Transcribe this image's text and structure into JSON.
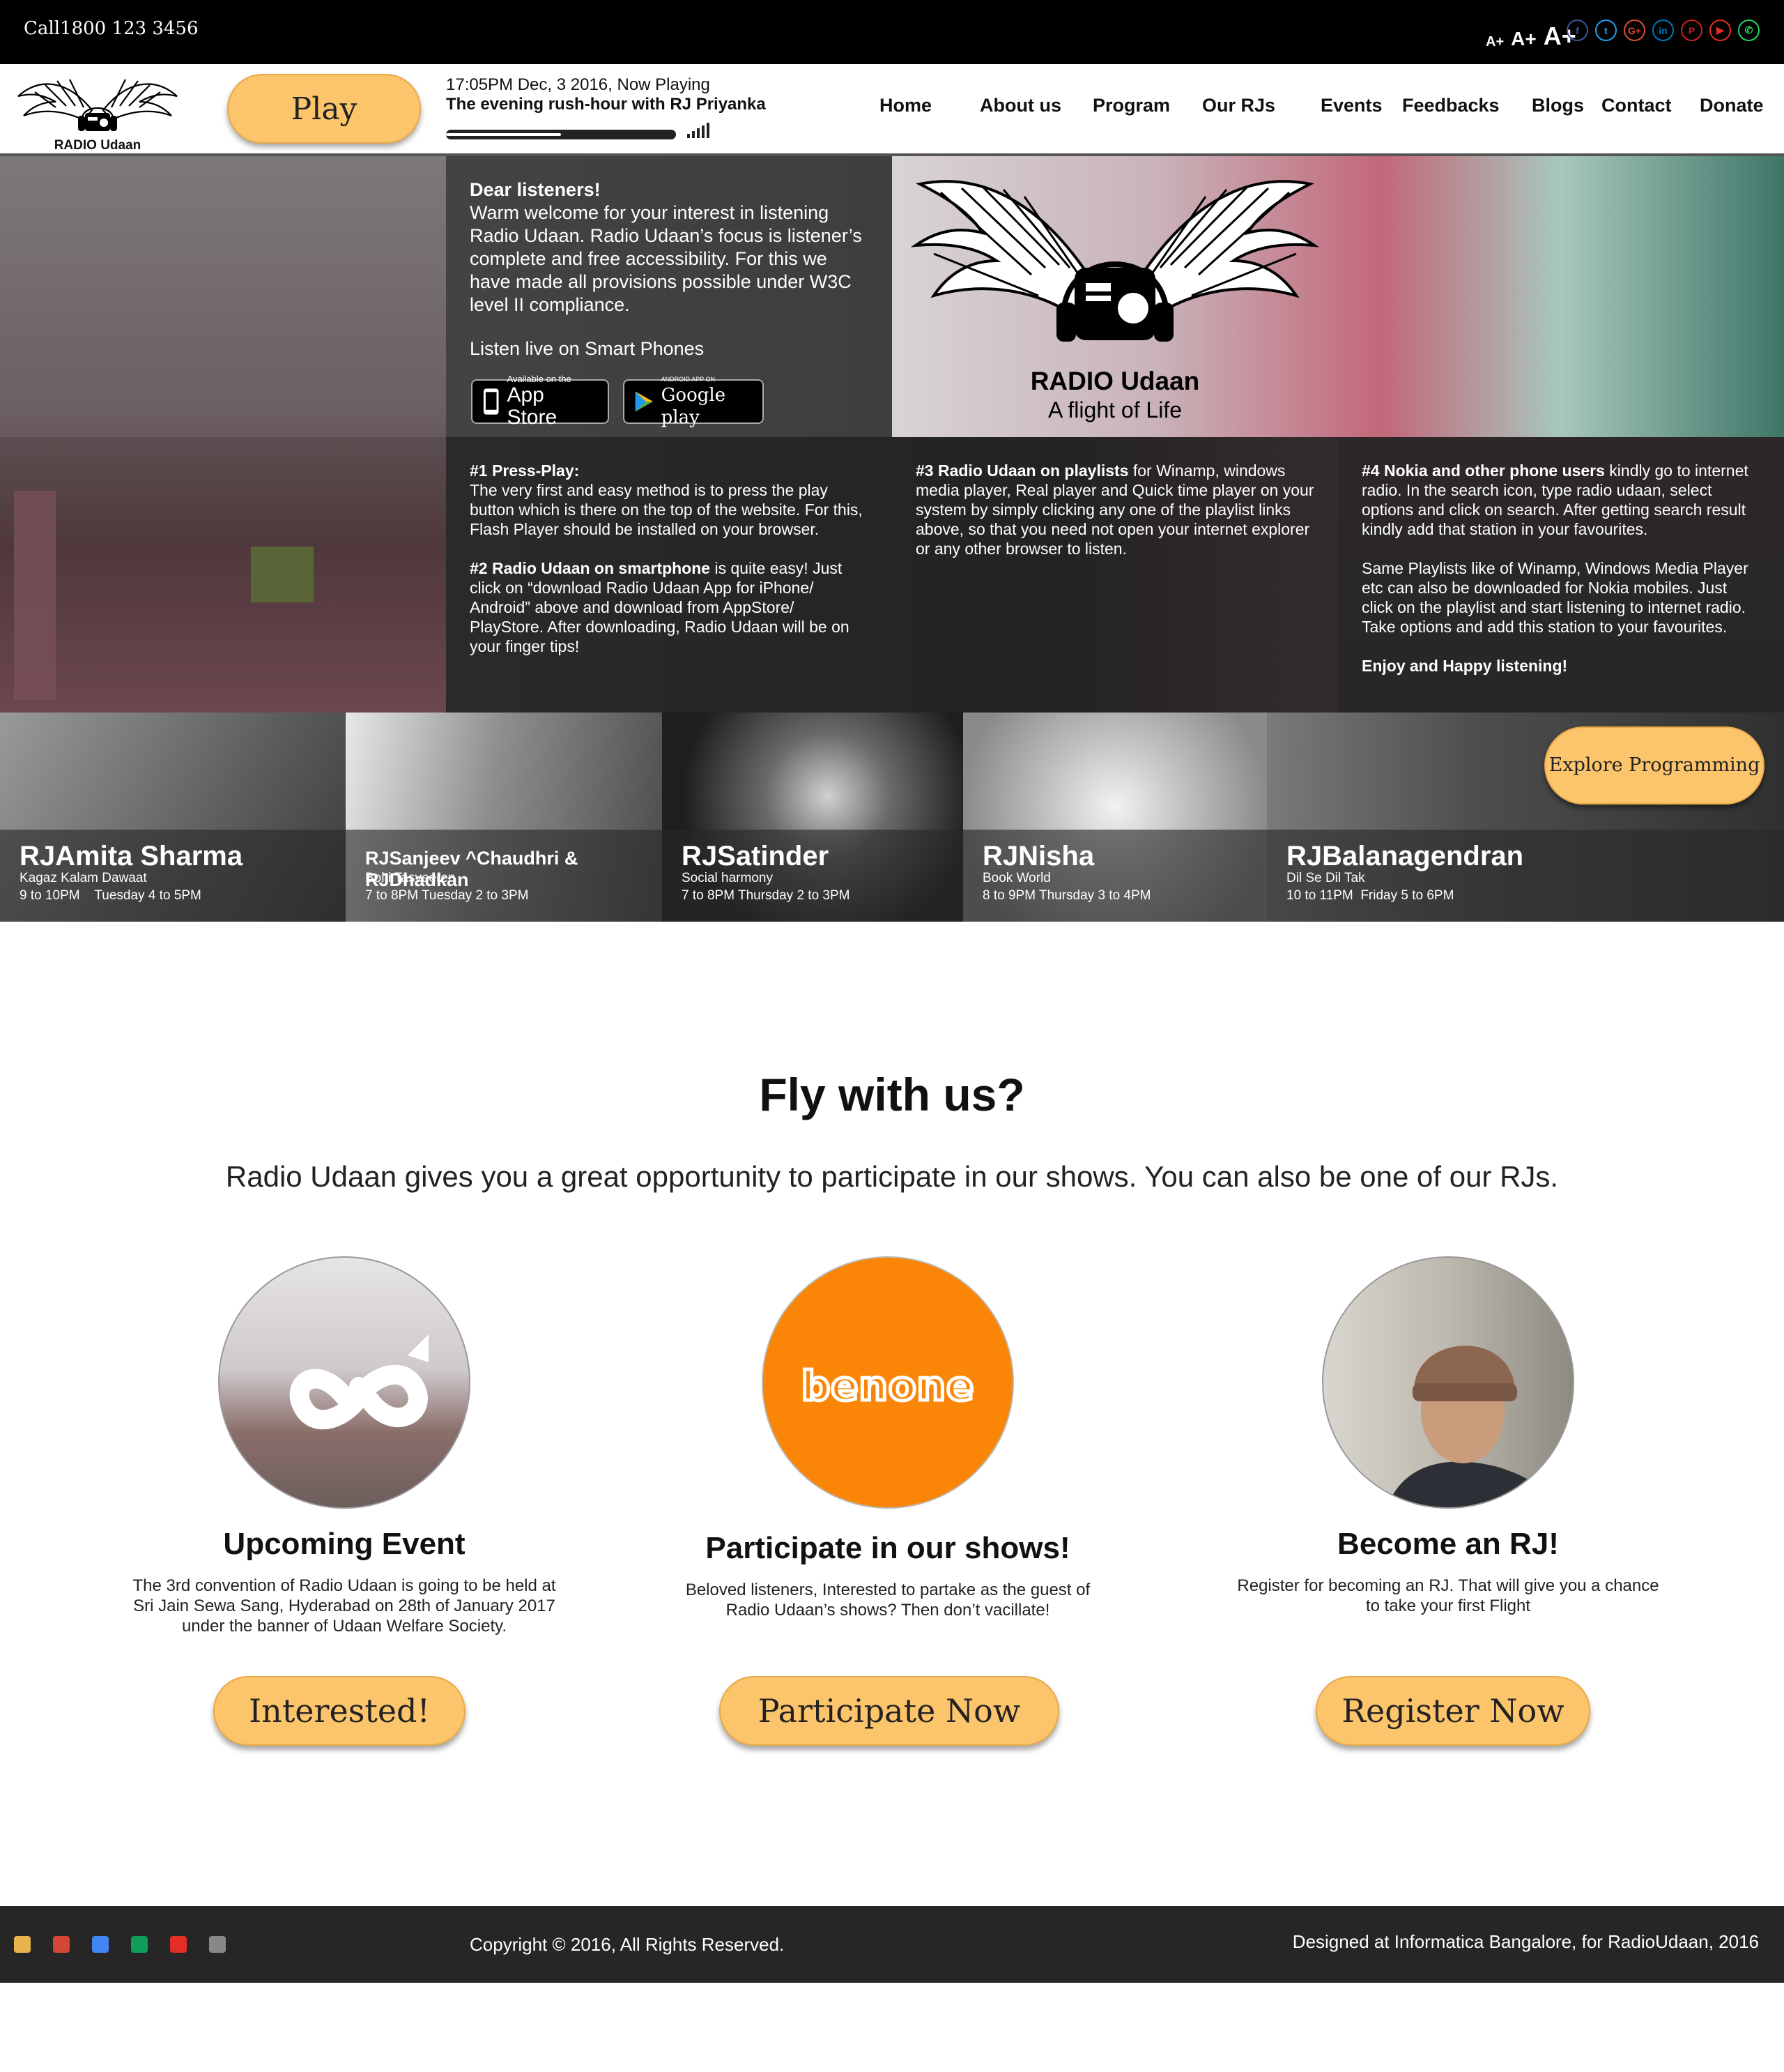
{
  "topbar": {
    "call": "Call1800 123 3456",
    "font_controls": [
      "A+",
      "A+",
      "A+"
    ],
    "socials": [
      {
        "icon": "facebook-icon",
        "glyph": "f",
        "color": "#3b5998"
      },
      {
        "icon": "twitter-icon",
        "glyph": "t",
        "color": "#1da1f2"
      },
      {
        "icon": "google-plus-icon",
        "glyph": "G+",
        "color": "#dd4b39"
      },
      {
        "icon": "linkedin-icon",
        "glyph": "in",
        "color": "#0077b5"
      },
      {
        "icon": "pinterest-icon",
        "glyph": "P",
        "color": "#cb2027"
      },
      {
        "icon": "youtube-icon",
        "glyph": "▶",
        "color": "#e52d27"
      },
      {
        "icon": "whatsapp-icon",
        "glyph": "✆",
        "color": "#25d366"
      }
    ]
  },
  "header": {
    "logo_text": "RADIO Udaan",
    "play_label": "Play",
    "now_time": "17:05PM Dec, 3 2016, Now Playing",
    "now_show": "The evening rush-hour with RJ Priyanka",
    "progress": 0.5,
    "nav": [
      "Home",
      "About us",
      "Program",
      "Our RJs",
      "Events",
      "Feedbacks",
      "Blogs",
      "Contact",
      "Donate"
    ]
  },
  "hero": {
    "welcome_title": "Dear listeners!",
    "welcome_body": "Warm welcome for your interest in listening Radio Udaan. Radio Udaan’s focus is listener’s complete and free accessibility. For this we have made all provisions possible under W3C level II compliance.",
    "listen_live": "Listen live on Smart Phones",
    "appstore_small": "Available on the",
    "appstore_big": "App Store",
    "googleplay_small": "ANDROID APP ON",
    "googleplay_big": "Google play",
    "brand_name": "RADIO Udaan",
    "brand_tagline": "A flight of Life",
    "step1_title": "#1 Press-Play:",
    "step1_body": "The very first and easy method is to press the play button which is there on the top of the website. For this, Flash Player should be installed on your browser.",
    "step2_title": "#2 Radio Udaan on smartphone",
    "step2_body": " is quite easy! Just click on “download Radio Udaan App for iPhone/ Android”  above and download from AppStore/ PlayStore. After downloading, Radio Udaan will be on your finger tips!",
    "step3_title": "#3 Radio Udaan on playlists",
    "step3_body": " for Winamp, windows media player, Real player and Quick time player on your system by simply clicking any one of the playlist links above, so that you need not open your internet explorer or any other browser to listen.",
    "step4_title": "#4 Nokia and other phone users",
    "step4_body": " kindly go to internet radio. In the search icon, type radio udaan, select options and click on search. After getting search result kindly add that station in your favourites.",
    "step4_more": "Same Playlists like of  Winamp, Windows Media Player etc can also be downloaded for Nokia mobiles. Just click on the playlist and start listening to internet radio. Take options and add this station to your favourites.",
    "step4_end": "Enjoy and Happy listening!"
  },
  "rjs": [
    {
      "name": "RJAmita Sharma",
      "show": "Kagaz Kalam Dawaat",
      "time": "9 to 10PM    Tuesday 4 to 5PM"
    },
    {
      "name": "RJSanjeev ^Chaudhri & RJDhadkan",
      "show": "Bolti Tasveeren",
      "time": "7 to 8PM Tuesday 2 to 3PM"
    },
    {
      "name": "RJSatinder",
      "show": "Social harmony",
      "time": "7 to 8PM Thursday 2 to 3PM"
    },
    {
      "name": "RJNisha",
      "show": "Book World",
      "time": "8 to 9PM Thursday 3 to 4PM"
    },
    {
      "name": "RJBalanagendran",
      "show": "Dil Se Dil Tak",
      "time": "10 to 11PM  Friday 5 to 6PM"
    }
  ],
  "explore_label": "Explore Programming",
  "fly": {
    "title": "Fly with us?",
    "subtitle": "Radio Udaan gives you a great opportunity to participate in our shows. You can also be one of our RJs."
  },
  "cards": [
    {
      "title": "Upcoming  Event",
      "desc": "The 3rd convention of Radio Udaan is going to be held at Sri Jain Sewa Sang, Hyderabad on 28th of January 2017 under the banner of Udaan Welfare Society.",
      "button": "Interested!"
    },
    {
      "title": "Participate in our shows!",
      "desc": "Beloved listeners, Interested to partake as the guest of Radio Udaan’s shows? Then don’t vacillate!",
      "button": "Participate Now",
      "logo_text": "benone"
    },
    {
      "title": "Become an RJ!",
      "desc": "Register for becoming an RJ. That will give you a chance to take your first Flight",
      "button": "Register Now"
    }
  ],
  "footer": {
    "icons": [
      {
        "name": "chrome-icon",
        "color": "#e8b34a"
      },
      {
        "name": "gmail-icon",
        "color": "#d44638"
      },
      {
        "name": "google-icon",
        "color": "#4285f4"
      },
      {
        "name": "drive-icon",
        "color": "#0f9d58"
      },
      {
        "name": "youtube-icon",
        "color": "#e52d27"
      },
      {
        "name": "apps-grid-icon",
        "color": "#888888"
      }
    ],
    "copyright": "Copyright © 2016, All Rights Reserved.",
    "designed": "Designed at Informatica Bangalore, for  RadioUdaan, 2016"
  }
}
